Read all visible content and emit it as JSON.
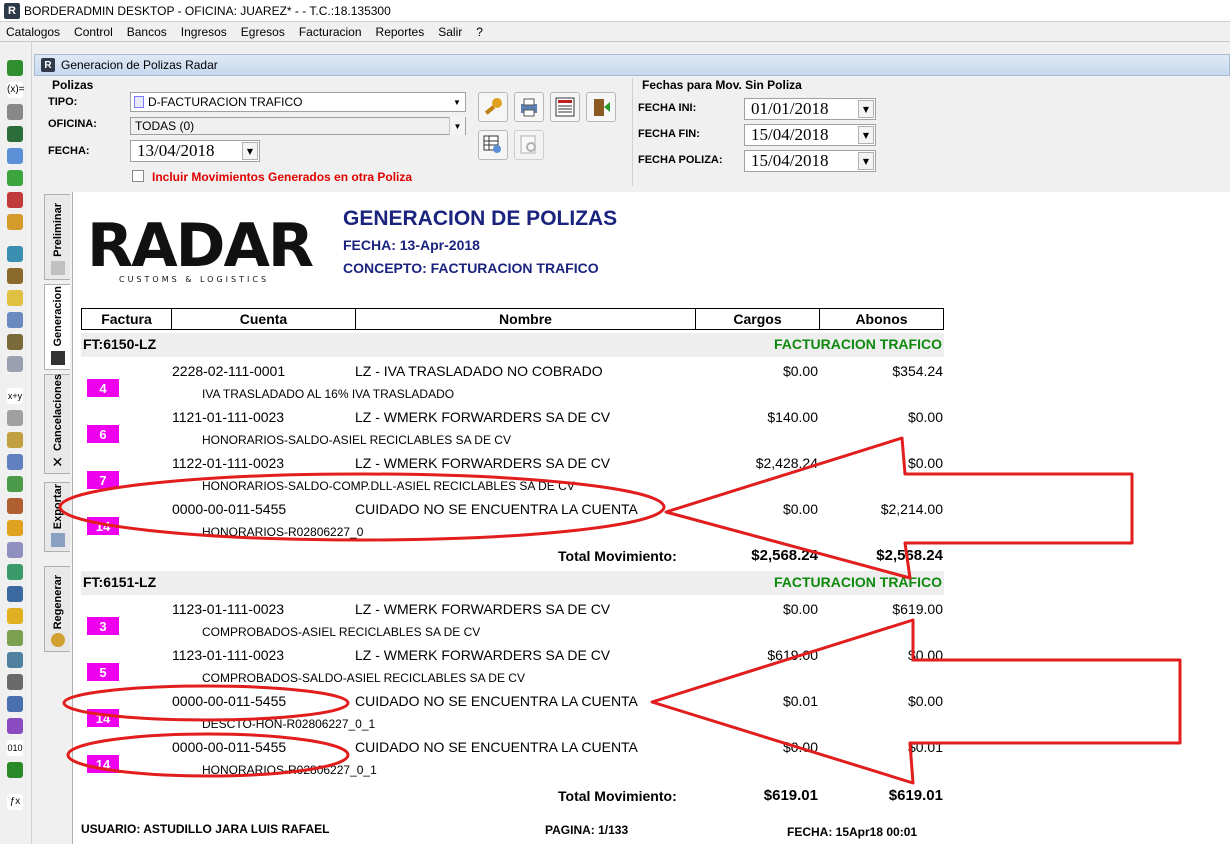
{
  "window": {
    "title": "BORDERADMIN DESKTOP - OFICINA: JUAREZ* -  - T.C.:18.135300",
    "logo_letter": "R"
  },
  "menu": [
    "Catalogos",
    "Control",
    "Bancos",
    "Ingresos",
    "Egresos",
    "Facturacion",
    "Reportes",
    "Salir",
    "?"
  ],
  "child_window": {
    "title": "Generacion de Polizas Radar",
    "logo_letter": "R"
  },
  "polizas": {
    "group_title": "Polizas",
    "tipo_label": "TIPO:",
    "tipo_value": "D-FACTURACION TRAFICO",
    "oficina_label": "OFICINA:",
    "oficina_value": "TODAS (0)",
    "fecha_label": "FECHA:",
    "fecha_value": "13/04/2018",
    "include_label": "Incluir Movimientos Generados en otra Poliza"
  },
  "fechas": {
    "group_title": "Fechas para Mov. Sin Poliza",
    "ini_label": "FECHA INI:",
    "ini_value": "01/01/2018",
    "fin_label": "FECHA FIN:",
    "fin_value": "15/04/2018",
    "poliza_label": "FECHA POLIZA:",
    "poliza_value": "15/04/2018"
  },
  "side_tabs": [
    "Preliminar",
    "Generacion",
    "Cancelaciones",
    "Exportar",
    "Regenerar"
  ],
  "report": {
    "logo_text": "RADAR",
    "logo_sub": "CUSTOMS & LOGISTICS",
    "title": "GENERACION DE POLIZAS",
    "fecha": "FECHA: 13-Apr-2018",
    "concepto": "CONCEPTO: FACTURACION TRAFICO",
    "columns": [
      "Factura",
      "Cuenta",
      "Nombre",
      "Cargos",
      "Abonos"
    ],
    "groups": [
      {
        "id": "FT:6150-LZ",
        "concept": "FACTURACION TRAFICO",
        "rows": [
          {
            "num": "4",
            "account": "2228-02-111-0001",
            "name": "LZ - IVA TRASLADADO NO COBRADO",
            "cargo": "$0.00",
            "abono": "$354.24",
            "desc": "IVA TRASLADADO AL 16% IVA TRASLADADO"
          },
          {
            "num": "6",
            "account": "1121-01-111-0023",
            "name": "LZ - WMERK FORWARDERS SA DE CV",
            "cargo": "$140.00",
            "abono": "$0.00",
            "desc": "HONORARIOS-SALDO-ASIEL RECICLABLES SA DE CV"
          },
          {
            "num": "7",
            "account": "1122-01-111-0023",
            "name": "LZ - WMERK FORWARDERS SA DE CV",
            "cargo": "$2,428.24",
            "abono": "$0.00",
            "desc": "HONORARIOS-SALDO-COMP.DLL-ASIEL RECICLABLES SA DE CV"
          },
          {
            "num": "14",
            "account": "0000-00-011-5455",
            "name": "CUIDADO NO SE ENCUENTRA LA CUENTA",
            "cargo": "$0.00",
            "abono": "$2,214.00",
            "desc": "HONORARIOS-R02806227_0"
          }
        ],
        "total_label": "Total Movimiento:",
        "total_cargos": "$2,568.24",
        "total_abonos": "$2,568.24"
      },
      {
        "id": "FT:6151-LZ",
        "concept": "FACTURACION TRAFICO",
        "rows": [
          {
            "num": "3",
            "account": "1123-01-111-0023",
            "name": "LZ - WMERK FORWARDERS SA DE CV",
            "cargo": "$0.00",
            "abono": "$619.00",
            "desc": "COMPROBADOS-ASIEL RECICLABLES SA DE CV"
          },
          {
            "num": "5",
            "account": "1123-01-111-0023",
            "name": "LZ - WMERK FORWARDERS SA DE CV",
            "cargo": "$619.00",
            "abono": "$0.00",
            "desc": "COMPROBADOS-SALDO-ASIEL RECICLABLES SA DE CV"
          },
          {
            "num": "14",
            "account": "0000-00-011-5455",
            "name": "CUIDADO NO SE ENCUENTRA LA CUENTA",
            "cargo": "$0.01",
            "abono": "$0.00",
            "desc": "DESCTO-HON-R02806227_0_1"
          },
          {
            "num": "14",
            "account": "0000-00-011-5455",
            "name": "CUIDADO NO SE ENCUENTRA LA CUENTA",
            "cargo": "$0.00",
            "abono": "$0.01",
            "desc": "HONORARIOS-R02806227_0_1"
          }
        ],
        "total_label": "Total Movimiento:",
        "total_cargos": "$619.01",
        "total_abonos": "$619.01"
      }
    ],
    "footer": {
      "usuario": "USUARIO: ASTUDILLO JARA LUIS RAFAEL",
      "pagina": "PAGINA: 1/133",
      "fecha": "FECHA: 15Apr18 00:01"
    }
  },
  "colors": {
    "annotation": "#e11d1d",
    "factura_badge": "#ee00ee",
    "concept_green": "#0d8a0d",
    "report_title": "#1a237e"
  }
}
